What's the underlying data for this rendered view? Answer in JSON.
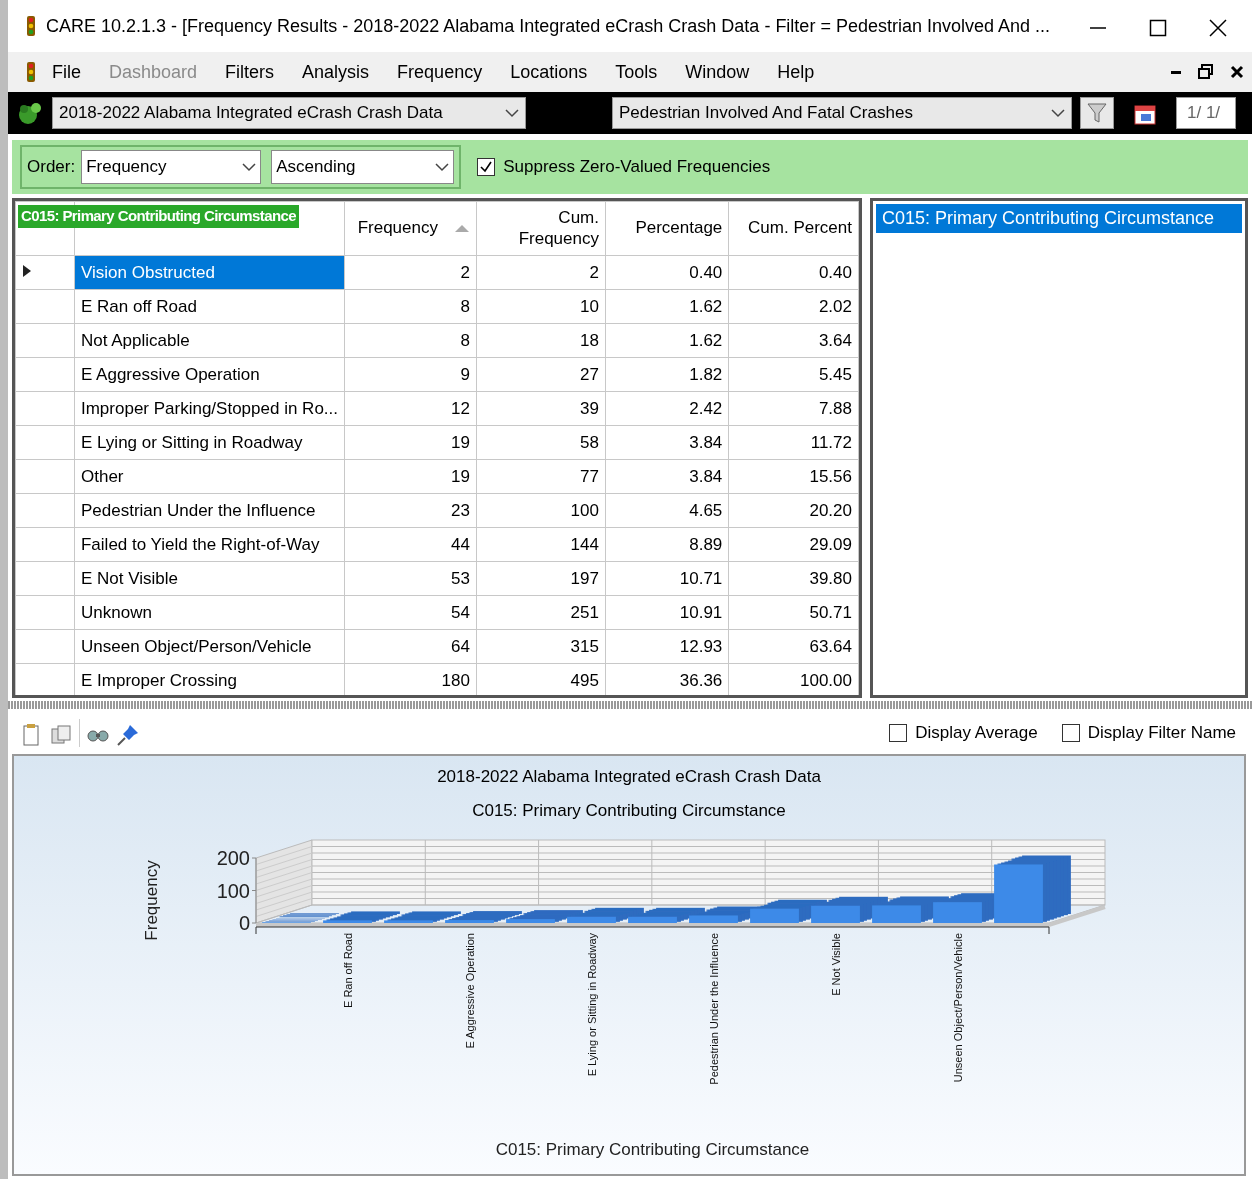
{
  "window": {
    "title": "CARE 10.2.1.3 - [Frequency Results - 2018-2022 Alabama Integrated eCrash Crash Data - Filter = Pedestrian Involved And ..."
  },
  "menu": [
    {
      "label": "File",
      "disabled": false
    },
    {
      "label": "Dashboard",
      "disabled": true
    },
    {
      "label": "Filters",
      "disabled": false
    },
    {
      "label": "Analysis",
      "disabled": false
    },
    {
      "label": "Frequency",
      "disabled": false
    },
    {
      "label": "Locations",
      "disabled": false
    },
    {
      "label": "Tools",
      "disabled": false
    },
    {
      "label": "Window",
      "disabled": false
    },
    {
      "label": "Help",
      "disabled": false
    }
  ],
  "toolbar": {
    "dataset": "2018-2022 Alabama Integrated eCrash Crash Data",
    "filter": "Pedestrian Involved And Fatal Crashes",
    "page": "1/ 1/"
  },
  "options": {
    "order_label": "Order:",
    "order": "Frequency",
    "direction": "Ascending",
    "suppress_zero": {
      "label": "Suppress Zero-Valued Frequencies",
      "checked": true
    }
  },
  "table": {
    "caption": "C015: Primary Contributing Circumstance",
    "columns": [
      {
        "label": "Frequency",
        "sorted": true
      },
      {
        "label": "Cum.\nFrequency",
        "sorted": false
      },
      {
        "label": "Percentage",
        "sorted": false
      },
      {
        "label": "Cum. Percent",
        "sorted": false
      }
    ],
    "rows": [
      {
        "value": "Vision Obstructed",
        "frequency": "2",
        "cum_frequency": "2",
        "percentage": "0.40",
        "cum_percent": "0.40",
        "selected": true
      },
      {
        "value": "E Ran off Road",
        "frequency": "8",
        "cum_frequency": "10",
        "percentage": "1.62",
        "cum_percent": "2.02",
        "selected": false
      },
      {
        "value": "Not Applicable",
        "frequency": "8",
        "cum_frequency": "18",
        "percentage": "1.62",
        "cum_percent": "3.64",
        "selected": false
      },
      {
        "value": "E Aggressive Operation",
        "frequency": "9",
        "cum_frequency": "27",
        "percentage": "1.82",
        "cum_percent": "5.45",
        "selected": false
      },
      {
        "value": "Improper Parking/Stopped in Ro...",
        "frequency": "12",
        "cum_frequency": "39",
        "percentage": "2.42",
        "cum_percent": "7.88",
        "selected": false
      },
      {
        "value": "E Lying or Sitting in Roadway",
        "frequency": "19",
        "cum_frequency": "58",
        "percentage": "3.84",
        "cum_percent": "11.72",
        "selected": false
      },
      {
        "value": "Other",
        "frequency": "19",
        "cum_frequency": "77",
        "percentage": "3.84",
        "cum_percent": "15.56",
        "selected": false
      },
      {
        "value": "Pedestrian Under the Influence",
        "frequency": "23",
        "cum_frequency": "100",
        "percentage": "4.65",
        "cum_percent": "20.20",
        "selected": false
      },
      {
        "value": "Failed to Yield the Right-of-Way",
        "frequency": "44",
        "cum_frequency": "144",
        "percentage": "8.89",
        "cum_percent": "29.09",
        "selected": false
      },
      {
        "value": "E Not Visible",
        "frequency": "53",
        "cum_frequency": "197",
        "percentage": "10.71",
        "cum_percent": "39.80",
        "selected": false
      },
      {
        "value": "Unknown",
        "frequency": "54",
        "cum_frequency": "251",
        "percentage": "10.91",
        "cum_percent": "50.71",
        "selected": false
      },
      {
        "value": "Unseen Object/Person/Vehicle",
        "frequency": "64",
        "cum_frequency": "315",
        "percentage": "12.93",
        "cum_percent": "63.64",
        "selected": false
      },
      {
        "value": "E Improper Crossing",
        "frequency": "180",
        "cum_frequency": "495",
        "percentage": "36.36",
        "cum_percent": "100.00",
        "selected": false
      }
    ]
  },
  "side_panel": {
    "header": "C015: Primary Contributing Circumstance"
  },
  "chart_options": [
    {
      "label": "Display Average",
      "checked": false
    },
    {
      "label": "Display Filter Name",
      "checked": false
    }
  ],
  "chart": {
    "chart_data": {
      "type": "bar",
      "title": "2018-2022 Alabama Integrated eCrash Crash Data\nC015: Primary Contributing Circumstance",
      "xlabel": "C015: Primary Contributing Circumstance",
      "ylabel": "Frequency",
      "categories": [
        null,
        "E Ran off Road",
        null,
        "E Aggressive Operation",
        null,
        "E Lying or Sitting in Roadway",
        null,
        "Pedestrian Under  the Influence",
        null,
        "E Not Visible",
        null,
        "Unseen Object/Person/Vehicle",
        null
      ],
      "values": [
        2,
        8,
        8,
        9,
        12,
        19,
        19,
        23,
        44,
        53,
        54,
        64,
        180
      ],
      "ylim": [
        0,
        200
      ],
      "yticks": [
        0,
        100,
        200
      ]
    }
  }
}
